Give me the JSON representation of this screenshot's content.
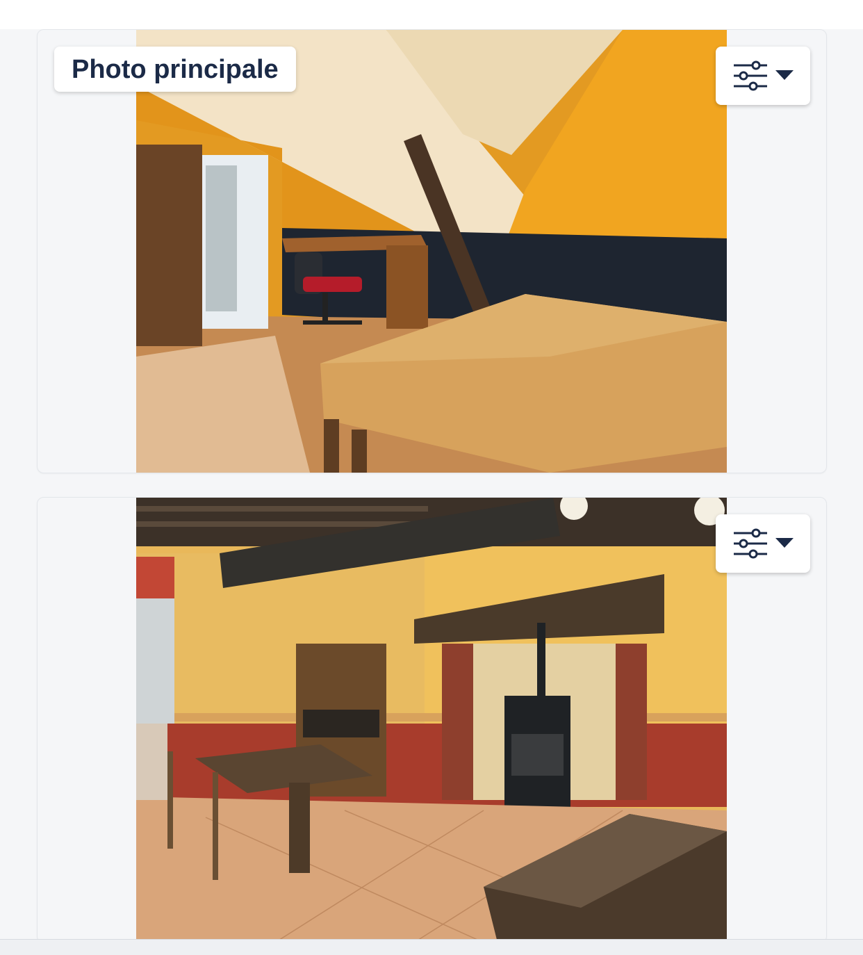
{
  "photos": [
    {
      "badge": "Photo principale",
      "options_icon": "sliders-icon",
      "menu_icon": "caret-down-icon"
    },
    {
      "options_icon": "sliders-icon",
      "menu_icon": "caret-down-icon"
    }
  ],
  "colors": {
    "badge_text": "#1b2a47",
    "icon": "#1b2a47",
    "page_background": "#f5f6f8"
  }
}
